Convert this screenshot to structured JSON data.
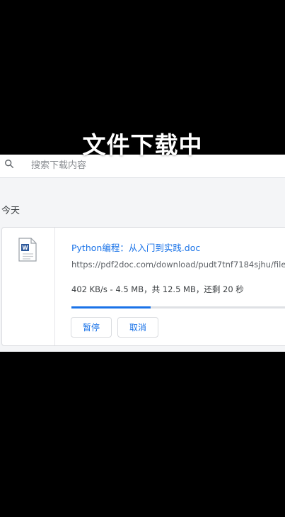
{
  "caption": "文件下载中",
  "search": {
    "placeholder": "搜索下载内容"
  },
  "section": {
    "label": "今天"
  },
  "download": {
    "file_icon": "word-document-icon",
    "file_name": "Python编程：从入门到实践.doc",
    "url": "https://pdf2doc.com/download/pudt7tnf7184sjhu/file_",
    "status": "402 KB/s - 4.5 MB，共 12.5 MB，还剩 20 秒",
    "progress": 0.36,
    "pause_label": "暂停",
    "cancel_label": "取消"
  },
  "colors": {
    "accent": "#1a73e8",
    "progress_track": "#dfe1e5"
  }
}
